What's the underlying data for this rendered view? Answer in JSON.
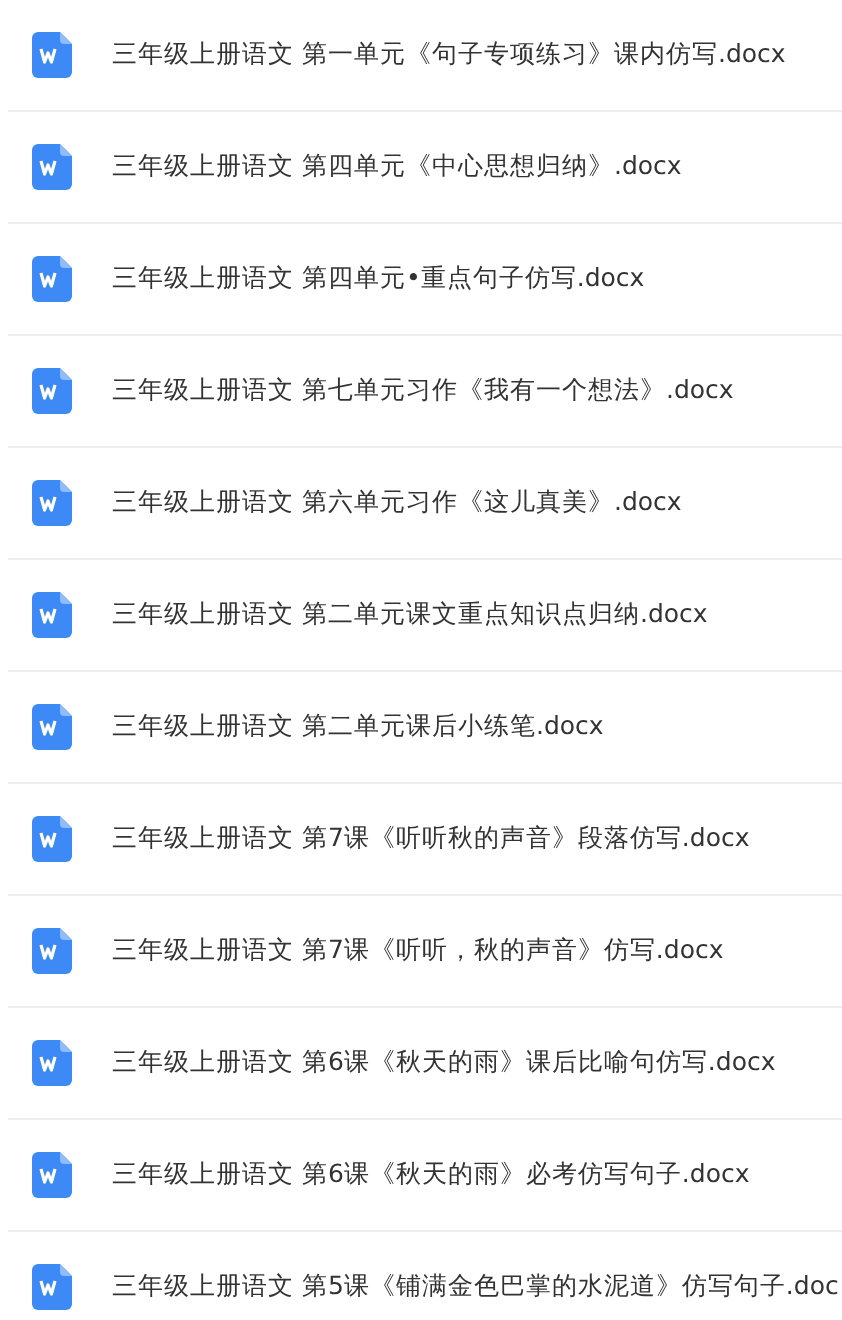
{
  "files": [
    {
      "name": "三年级上册语文 第一单元《句子专项练习》课内仿写.docx"
    },
    {
      "name": "三年级上册语文 第四单元《中心思想归纳》.docx"
    },
    {
      "name": "三年级上册语文 第四单元•重点句子仿写.docx"
    },
    {
      "name": "三年级上册语文 第七单元习作《我有一个想法》.docx"
    },
    {
      "name": "三年级上册语文 第六单元习作《这儿真美》.docx"
    },
    {
      "name": "三年级上册语文 第二单元课文重点知识点归纳.docx"
    },
    {
      "name": "三年级上册语文 第二单元课后小练笔.docx"
    },
    {
      "name": "三年级上册语文 第7课《听听秋的声音》段落仿写.docx"
    },
    {
      "name": "三年级上册语文 第7课《听听，秋的声音》仿写.docx"
    },
    {
      "name": "三年级上册语文 第6课《秋天的雨》课后比喻句仿写.docx"
    },
    {
      "name": "三年级上册语文 第6课《秋天的雨》必考仿写句子.docx"
    },
    {
      "name": "三年级上册语文 第5课《铺满金色巴掌的水泥道》仿写句子.doc"
    }
  ]
}
